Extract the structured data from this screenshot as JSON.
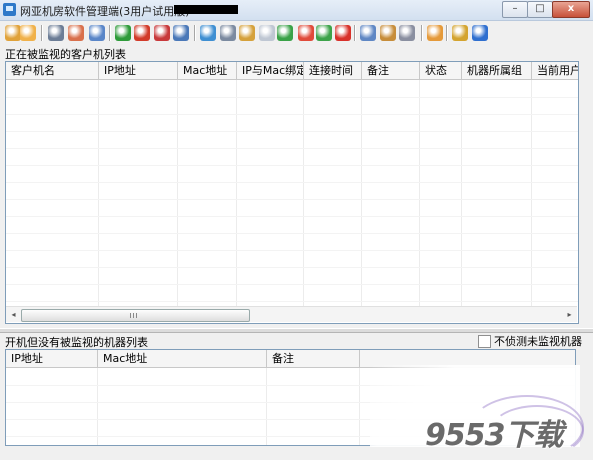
{
  "window": {
    "title": "网亚机房软件管理端(3用户试用版)",
    "minimize_glyph": "–",
    "maximize_glyph": "□",
    "close_glyph": "x"
  },
  "toolbar": {
    "buttons": [
      {
        "icon": "pencil-icon",
        "color": "#e0a23a"
      },
      {
        "icon": "users-icon",
        "color": "#f0b14a"
      },
      {
        "icon": "printer-icon",
        "color": "#6c7d96"
      },
      {
        "icon": "group-icon",
        "color": "#d9704c"
      },
      {
        "icon": "magnifier-icon",
        "color": "#5a86c8"
      },
      {
        "icon": "arrow-right-icon",
        "color": "#2f9b3a"
      },
      {
        "icon": "brush-icon",
        "color": "#d23b2a"
      },
      {
        "icon": "record-icon",
        "color": "#c8393b"
      },
      {
        "icon": "monitor-icon",
        "color": "#4a78b8"
      },
      {
        "icon": "network-icon",
        "color": "#3f8fd2"
      },
      {
        "icon": "computer-icon",
        "color": "#7b8aa0"
      },
      {
        "icon": "gear-icon",
        "color": "#d5a13b"
      },
      {
        "icon": "document-icon",
        "color": "#bfc7d3"
      },
      {
        "icon": "green-arrow-icon",
        "color": "#3aa248"
      },
      {
        "icon": "power-icon",
        "color": "#e04a3a"
      },
      {
        "icon": "refresh-icon",
        "color": "#3da34a"
      },
      {
        "icon": "stop-icon",
        "color": "#d8312a"
      },
      {
        "icon": "tools-icon",
        "color": "#5f87c4"
      },
      {
        "icon": "wrench-icon",
        "color": "#c78d3a"
      },
      {
        "icon": "key-icon",
        "color": "#8a8fa0"
      },
      {
        "icon": "diamond-icon",
        "color": "#e59a3a"
      },
      {
        "icon": "settings-icon",
        "color": "#d4a42f"
      },
      {
        "icon": "help-icon",
        "color": "#2f6fcf"
      }
    ]
  },
  "clients_panel": {
    "label": "正在被监视的客户机列表",
    "columns": [
      "客户机名",
      "IP地址",
      "Mac地址",
      "IP与Mac绑定",
      "连接时间",
      "备注",
      "状态",
      "机器所属组",
      "当前用户"
    ]
  },
  "unmonitored_panel": {
    "label": "开机但没有被监视的机器列表",
    "checkbox_label": "不侦测未监视机器",
    "checkbox_checked": false,
    "columns": [
      "IP地址",
      "Mac地址",
      "备注"
    ]
  },
  "scrollbar": {
    "left_arrow": "◂",
    "right_arrow": "▸"
  },
  "watermark": {
    "text": "9553下载"
  }
}
